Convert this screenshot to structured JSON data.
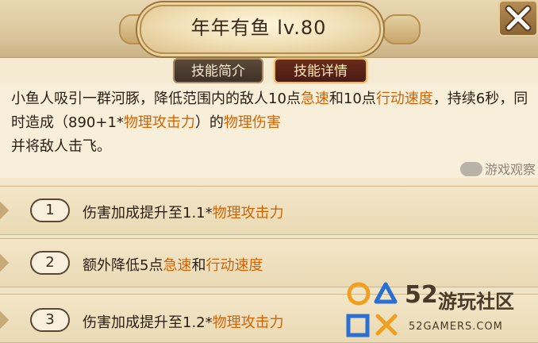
{
  "header": {
    "title": "年年有鱼  lv.80"
  },
  "tabs": [
    {
      "label": "技能简介",
      "active": false
    },
    {
      "label": "技能详情",
      "active": true
    }
  ],
  "description": {
    "p1": "小鱼人吸引一群河豚，降低范围内的敌人10点",
    "hl1": "急速",
    "p2": "和10点",
    "hl2": "行动速度",
    "p3": "，持续6秒，同时造成（890+1*",
    "hl3": "物理攻击力",
    "p4": "）的",
    "hl4": "物理伤害",
    "p5": "并将敌人击飞。"
  },
  "upgrades": [
    {
      "num": "1",
      "text": "伤害加成提升至1.1*",
      "highlight": "物理攻击力",
      "tail": ""
    },
    {
      "num": "2",
      "text": "额外降低5点",
      "highlight": "急速",
      "mid": "和",
      "highlight2": "行动速度"
    },
    {
      "num": "3",
      "text": "伤害加成提升至1.2*",
      "highlight": "物理攻击力",
      "tail": ""
    }
  ],
  "watermarks": {
    "top_right": "游戏观察",
    "logo_num": "52",
    "logo_cn": "游玩社区",
    "logo_en": "52GAMERS.COM"
  },
  "colors": {
    "highlight": "#d26300",
    "logo_orange": "#f0a020",
    "logo_blue": "#2a6fd1"
  },
  "icons": {
    "close": "close-x-icon"
  }
}
